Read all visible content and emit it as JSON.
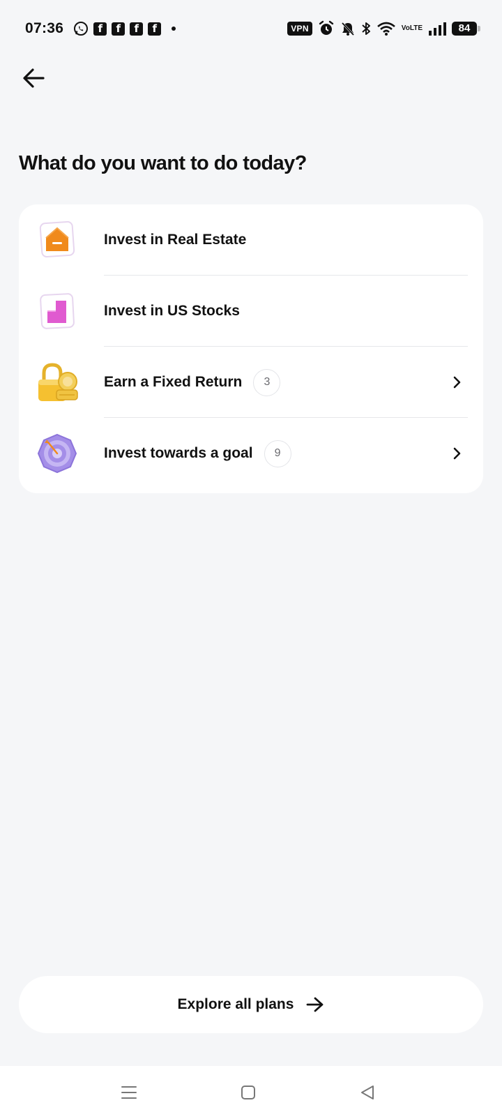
{
  "status_bar": {
    "time": "07:36",
    "vpn_label": "VPN",
    "volte_top": "Vo",
    "volte_bottom": "LTE",
    "battery": "84",
    "left_icons": [
      "whatsapp-icon",
      "facebook-icon",
      "facebook-icon",
      "facebook-icon",
      "facebook-icon",
      "notification-dot"
    ],
    "right_icons": [
      "vpn-badge",
      "alarm-icon",
      "mute-icon",
      "bluetooth-icon",
      "wifi-icon",
      "volte-icon",
      "signal-icon",
      "battery-icon"
    ]
  },
  "header": {
    "back_icon": "arrow-left-icon",
    "title": "What do you want to do today?"
  },
  "options": [
    {
      "label": "Invest in Real Estate",
      "icon": "real-estate-icon"
    },
    {
      "label": "Invest in US Stocks",
      "icon": "us-stocks-icon"
    },
    {
      "label": "Earn a Fixed Return",
      "count": "3",
      "icon": "lock-coin-icon",
      "chevron": "chevron-right-icon"
    },
    {
      "label": "Invest towards a goal",
      "count": "9",
      "icon": "target-goal-icon",
      "chevron": "chevron-right-icon"
    }
  ],
  "explore": {
    "label": "Explore all plans",
    "icon": "arrow-right-icon"
  },
  "nav": {
    "icons": [
      "menu-icon",
      "home-square-icon",
      "back-triangle-icon"
    ]
  },
  "colors": {
    "background": "#f5f6f8",
    "card": "#ffffff",
    "text": "#111111",
    "real_estate_orange": "#f08a1c",
    "stocks_pink": "#e05ad0",
    "gold": "#f5c030",
    "goal_purple": "#a48ee8"
  }
}
